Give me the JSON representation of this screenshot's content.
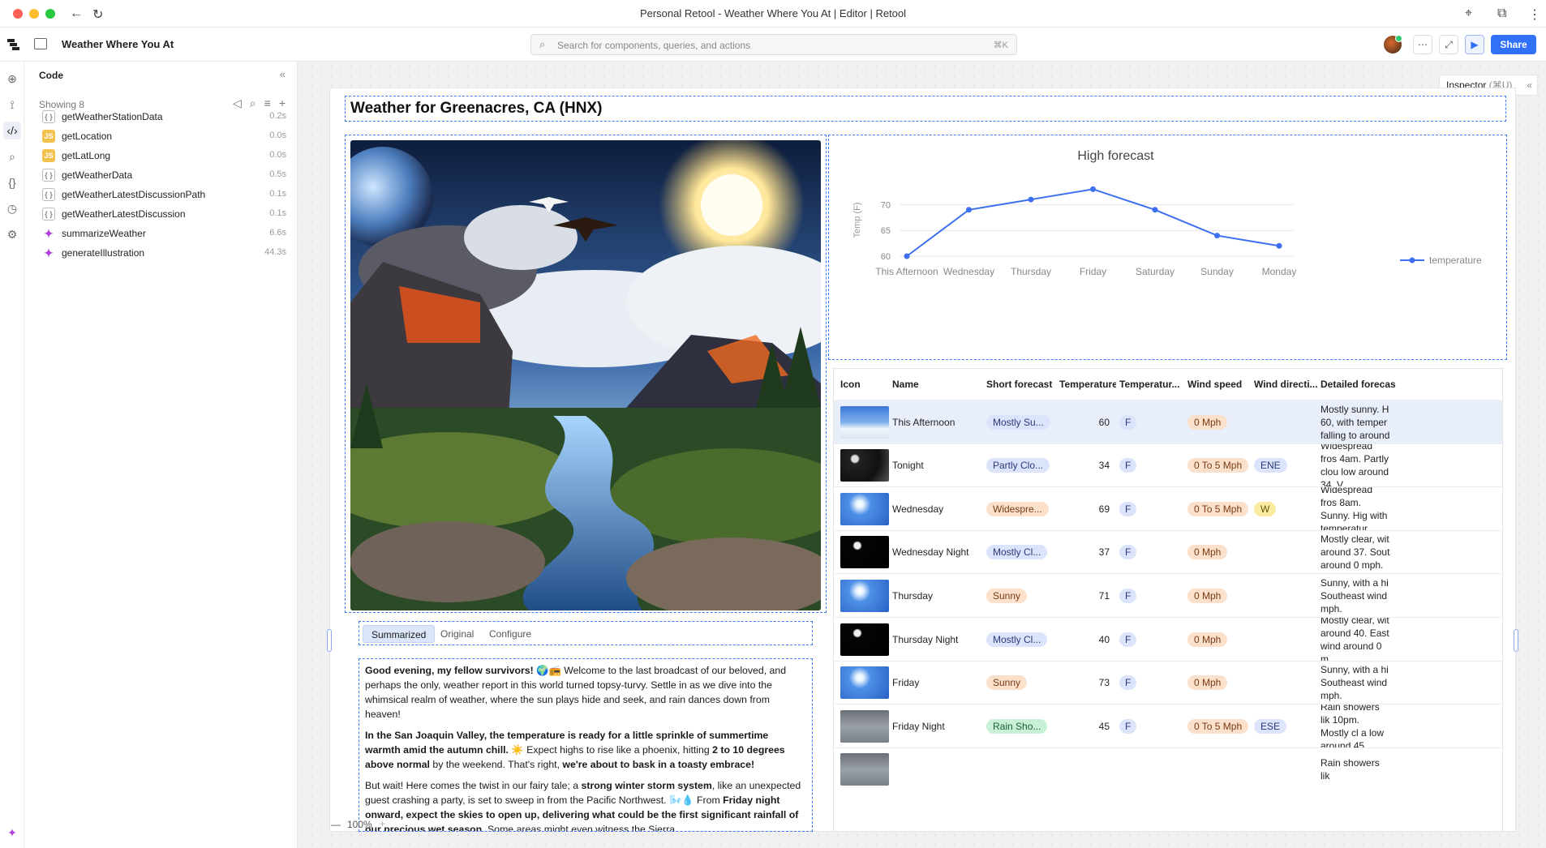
{
  "window": {
    "title": "Personal Retool - Weather Where You At | Editor | Retool"
  },
  "header": {
    "app_name": "Weather Where You At",
    "search_placeholder": "Search for components, queries, and actions",
    "search_shortcut": "⌘K",
    "share_label": "Share"
  },
  "code_panel": {
    "title": "Code",
    "showing": "Showing 8",
    "queries": [
      {
        "name": "getWeatherStationData",
        "time": "0.2s",
        "type": "ep"
      },
      {
        "name": "getLocation",
        "time": "0.0s",
        "type": "js"
      },
      {
        "name": "getLatLong",
        "time": "0.0s",
        "type": "js"
      },
      {
        "name": "getWeatherData",
        "time": "0.5s",
        "type": "ep"
      },
      {
        "name": "getWeatherLatestDiscussionPath",
        "time": "0.1s",
        "type": "ep"
      },
      {
        "name": "getWeatherLatestDiscussion",
        "time": "0.1s",
        "type": "ep"
      },
      {
        "name": "summarizeWeather",
        "time": "6.6s",
        "type": "ai"
      },
      {
        "name": "generateIllustration",
        "time": "44.3s",
        "type": "ai"
      }
    ],
    "js_badge": "JS",
    "ep_badge": "{ }",
    "ai_badge": "✦"
  },
  "zoom": {
    "value": "100%",
    "minus": "—",
    "plus": "+"
  },
  "inspector": {
    "label": "Inspector",
    "shortcut": "(⌘U)",
    "collapse": "«"
  },
  "page": {
    "heading": "Weather for Greenacres, CA (HNX)",
    "tabs": [
      "Summarized",
      "Original",
      "Configure"
    ],
    "summary": {
      "p1_bold": "Good evening, my fellow survivors!",
      "p1_rest": " 🌍📻 Welcome to the last broadcast of our beloved, and perhaps the only, weather report in this world turned topsy-turvy. Settle in as we dive into the whimsical realm of weather, where the sun plays hide and seek, and rain dances down from heaven!",
      "p2_bold1": "In the San Joaquin Valley, the temperature is ready for a little sprinkle of summertime warmth amid the autumn chill.",
      "p2_mid1": " ☀️ Expect highs to rise like a phoenix, hitting ",
      "p2_bold2": "2 to 10 degrees above normal",
      "p2_mid2": " by the weekend. That's right, ",
      "p2_bold3": "we're about to bask in a toasty embrace!",
      "p3_a": "But wait! Here comes the twist in our fairy tale; a ",
      "p3_bold1": "strong winter storm system",
      "p3_b": ", like an unexpected guest crashing a party, is set to sweep in from the Pacific Northwest. 🌬️💧 From ",
      "p3_bold2": "Friday night onward, expect the skies to open up, delivering what could be the first significant rainfall of our precious wet season.",
      "p3_c": " Some areas might even witness the Sierra"
    }
  },
  "chart_data": {
    "type": "line",
    "title": "High forecast",
    "ylabel": "Temp (F)",
    "categories": [
      "This Afternoon",
      "Wednesday",
      "Thursday",
      "Friday",
      "Saturday",
      "Sunday",
      "Monday"
    ],
    "series": [
      {
        "name": "temperature",
        "values": [
          60,
          69,
          71,
          73,
          69,
          64,
          62
        ],
        "color": "#3e6ff0"
      }
    ],
    "yticks": [
      60,
      65,
      70
    ],
    "ylim": [
      60,
      74
    ],
    "legend": "right"
  },
  "table": {
    "columns": [
      "Icon",
      "Name",
      "Short forecast",
      "Temperature",
      "Temperatur...",
      "Wind speed",
      "Wind directi...",
      "Detailed forecas"
    ],
    "rows": [
      {
        "icon": "partly-sunny",
        "name": "This Afternoon",
        "short": "Mostly Su...",
        "short_color": "blue",
        "temp": "60",
        "unit": "F",
        "wind": "0 Mph",
        "dir": "",
        "dir_color": "",
        "detail": "Mostly sunny. H 60, with temper falling to around"
      },
      {
        "icon": "night-cloudy",
        "name": "Tonight",
        "short": "Partly Clo...",
        "short_color": "blue",
        "temp": "34",
        "unit": "F",
        "wind": "0 To 5 Mph",
        "dir": "ENE",
        "dir_color": "blue",
        "detail": "Widespread fros 4am. Partly clou low around 34. V"
      },
      {
        "icon": "sunny",
        "name": "Wednesday",
        "short": "Widespre...",
        "short_color": "orange",
        "temp": "69",
        "unit": "F",
        "wind": "0 To 5 Mph",
        "dir": "W",
        "dir_color": "yellow",
        "detail": "Widespread fros 8am. Sunny. Hig with temperatur"
      },
      {
        "icon": "night-clear",
        "name": "Wednesday Night",
        "short": "Mostly Cl...",
        "short_color": "blue",
        "temp": "37",
        "unit": "F",
        "wind": "0 Mph",
        "dir": "",
        "dir_color": "",
        "detail": "Mostly clear, wit around 37. Sout around 0 mph."
      },
      {
        "icon": "sunny",
        "name": "Thursday",
        "short": "Sunny",
        "short_color": "orange",
        "temp": "71",
        "unit": "F",
        "wind": "0 Mph",
        "dir": "",
        "dir_color": "",
        "detail": "Sunny, with a hi Southeast wind mph."
      },
      {
        "icon": "night-clear",
        "name": "Thursday Night",
        "short": "Mostly Cl...",
        "short_color": "blue",
        "temp": "40",
        "unit": "F",
        "wind": "0 Mph",
        "dir": "",
        "dir_color": "",
        "detail": "Mostly clear, wit around 40. East wind around 0 m"
      },
      {
        "icon": "sunny",
        "name": "Friday",
        "short": "Sunny",
        "short_color": "orange",
        "temp": "73",
        "unit": "F",
        "wind": "0 Mph",
        "dir": "",
        "dir_color": "",
        "detail": "Sunny, with a hi Southeast wind mph."
      },
      {
        "icon": "rain",
        "name": "Friday Night",
        "short": "Rain Sho...",
        "short_color": "green",
        "temp": "45",
        "unit": "F",
        "wind": "0 To 5 Mph",
        "dir": "ESE",
        "dir_color": "blue",
        "detail": "Rain showers lik 10pm. Mostly cl a low around 45"
      },
      {
        "icon": "rain",
        "name": "",
        "short": "",
        "short_color": "",
        "temp": "",
        "unit": "",
        "wind": "",
        "dir": "",
        "dir_color": "",
        "detail": "Rain showers lik"
      }
    ]
  }
}
